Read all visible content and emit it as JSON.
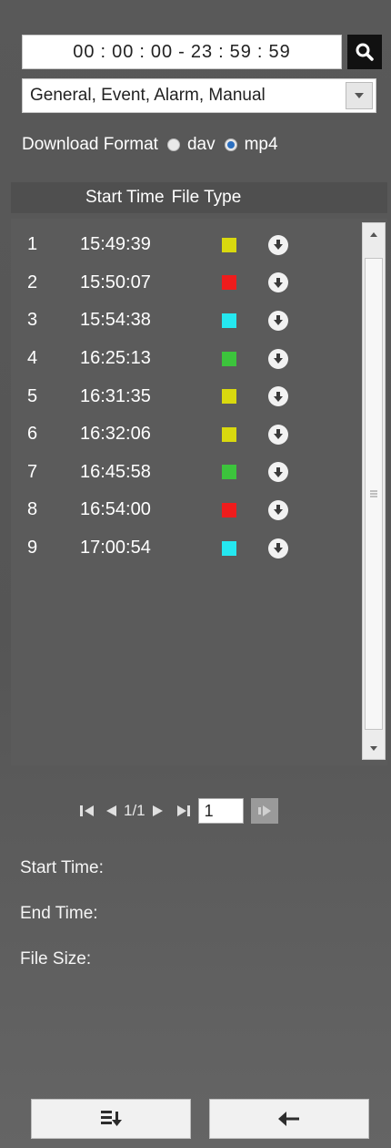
{
  "search": {
    "time_start": [
      "00",
      "00",
      "00"
    ],
    "time_end": [
      "23",
      "59",
      "59"
    ],
    "separator": ":",
    "dash": "-"
  },
  "filter": {
    "record_type": "General, Event, Alarm, Manual"
  },
  "format": {
    "label": "Download Format",
    "options": [
      "dav",
      "mp4"
    ],
    "selected": "mp4"
  },
  "table": {
    "headers": [
      "Start Time",
      "File Type"
    ],
    "rows": [
      {
        "index": "1",
        "time": "15:49:39",
        "color": "#d9d90e"
      },
      {
        "index": "2",
        "time": "15:50:07",
        "color": "#ee1c1c"
      },
      {
        "index": "3",
        "time": "15:54:38",
        "color": "#25e8f0"
      },
      {
        "index": "4",
        "time": "16:25:13",
        "color": "#3cc43c"
      },
      {
        "index": "5",
        "time": "16:31:35",
        "color": "#d9d90e"
      },
      {
        "index": "6",
        "time": "16:32:06",
        "color": "#d9d90e"
      },
      {
        "index": "7",
        "time": "16:45:58",
        "color": "#3cc43c"
      },
      {
        "index": "8",
        "time": "16:54:00",
        "color": "#ee1c1c"
      },
      {
        "index": "9",
        "time": "17:00:54",
        "color": "#25e8f0"
      }
    ]
  },
  "pager": {
    "page_text": "1/1",
    "page_input": "1"
  },
  "info": {
    "start_label": "Start Time:",
    "end_label": "End Time:",
    "size_label": "File Size:"
  },
  "icons": {
    "search": "search-icon",
    "dropdown": "chevron-down-icon",
    "download": "download-icon",
    "batch_download": "batch-download-icon",
    "back": "back-arrow-icon"
  }
}
